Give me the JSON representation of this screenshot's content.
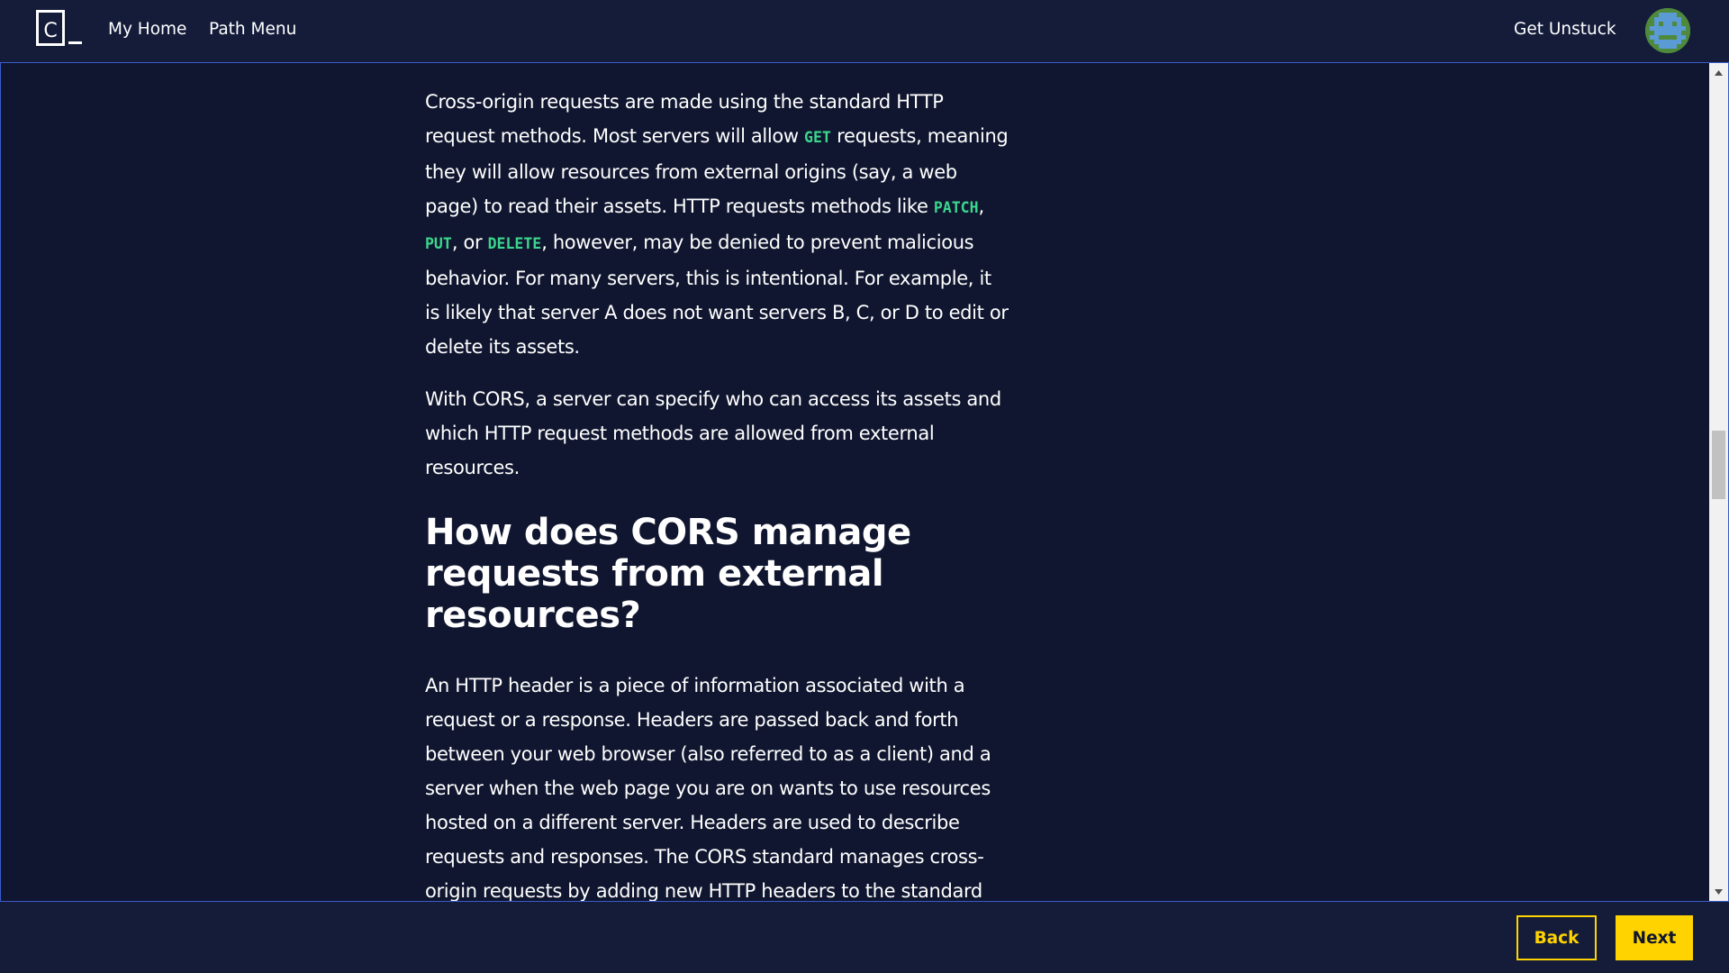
{
  "nav": {
    "logo_text": "C",
    "my_home": "My Home",
    "path_menu": "Path Menu",
    "get_unstuck": "Get Unstuck"
  },
  "article": {
    "p1": {
      "t1": "Cross-origin requests are made using the standard HTTP request methods. Most servers will allow ",
      "c1": "GET",
      "t2": " requests, meaning they will allow resources from external origins (say, a web page) to read their assets. HTTP requests methods like ",
      "c2": "PATCH",
      "t3": ", ",
      "c3": "PUT",
      "t4": ", or ",
      "c4": "DELETE",
      "t5": ", however, may be denied to prevent malicious behavior. For many servers, this is intentional. For example, it is likely that server A does not want servers B, C, or D to edit or delete its assets."
    },
    "p2": "With CORS, a server can specify who can access its assets and which HTTP request methods are allowed from external resources.",
    "heading": "How does CORS manage requests from external resources?",
    "p3": "An HTTP header is a piece of information associated with a request or a response. Headers are passed back and forth between your web browser (also referred to as a client) and a server when the web page you are on wants to use resources hosted on a different server. Headers are used to describe requests and responses. The CORS standard manages cross-origin requests by adding new HTTP headers to the standard list of headers. The following are the new HTTP headers added by"
  },
  "footer": {
    "back": "Back",
    "next": "Next"
  },
  "colors": {
    "background": "#10162f",
    "bar": "#141c3a",
    "code": "#3bd68e",
    "accent": "#ffd300"
  },
  "icons": {
    "logo": "codecademy-logo-icon",
    "avatar": "pixel-avatar-icon",
    "scroll_up": "scroll-up-arrow-icon",
    "scroll_down": "scroll-down-arrow-icon"
  }
}
